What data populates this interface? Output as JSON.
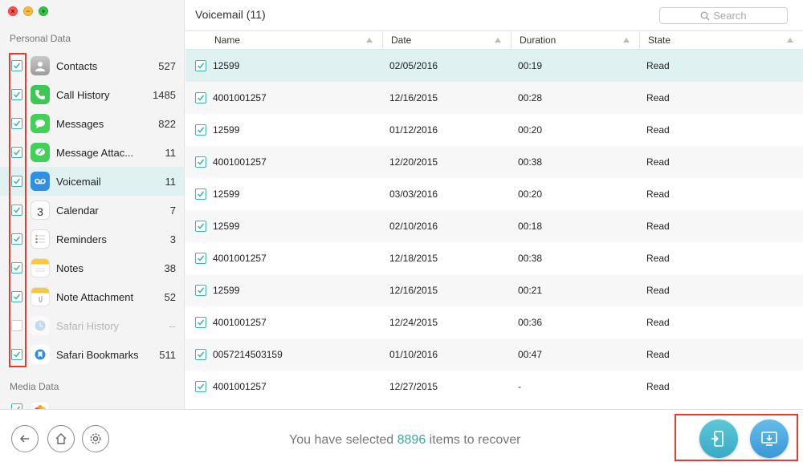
{
  "sidebar": {
    "personal_heading": "Personal Data",
    "media_heading": "Media Data",
    "items": [
      {
        "label": "Contacts",
        "count": "527",
        "icon": "contacts-icon",
        "checked": true
      },
      {
        "label": "Call History",
        "count": "1485",
        "icon": "phone-icon",
        "checked": true
      },
      {
        "label": "Messages",
        "count": "822",
        "icon": "messages-icon",
        "checked": true
      },
      {
        "label": "Message Attac...",
        "count": "11",
        "icon": "attachment-icon",
        "checked": true
      },
      {
        "label": "Voicemail",
        "count": "11",
        "icon": "voicemail-icon",
        "checked": true
      },
      {
        "label": "Calendar",
        "count": "7",
        "icon": "calendar-icon",
        "checked": true
      },
      {
        "label": "Reminders",
        "count": "3",
        "icon": "reminders-icon",
        "checked": true
      },
      {
        "label": "Notes",
        "count": "38",
        "icon": "notes-icon",
        "checked": true
      },
      {
        "label": "Note Attachment",
        "count": "52",
        "icon": "note-attachment-icon",
        "checked": true
      },
      {
        "label": "Safari History",
        "count": "--",
        "icon": "safari-history-icon",
        "checked": false
      },
      {
        "label": "Safari Bookmarks",
        "count": "511",
        "icon": "safari-bookmarks-icon",
        "checked": true
      }
    ],
    "calendar_day": "3"
  },
  "main": {
    "title": "Voicemail (11)",
    "search_placeholder": "Search",
    "columns": [
      "Name",
      "Date",
      "Duration",
      "State"
    ],
    "rows": [
      {
        "name": "12599",
        "date": "02/05/2016",
        "duration": "00:19",
        "state": "Read"
      },
      {
        "name": "4001001257",
        "date": "12/16/2015",
        "duration": "00:28",
        "state": "Read"
      },
      {
        "name": "12599",
        "date": "01/12/2016",
        "duration": "00:20",
        "state": "Read"
      },
      {
        "name": "4001001257",
        "date": "12/20/2015",
        "duration": "00:38",
        "state": "Read"
      },
      {
        "name": "12599",
        "date": "03/03/2016",
        "duration": "00:20",
        "state": "Read"
      },
      {
        "name": "12599",
        "date": "02/10/2016",
        "duration": "00:18",
        "state": "Read"
      },
      {
        "name": "4001001257",
        "date": "12/18/2015",
        "duration": "00:38",
        "state": "Read"
      },
      {
        "name": "12599",
        "date": "12/16/2015",
        "duration": "00:21",
        "state": "Read"
      },
      {
        "name": "4001001257",
        "date": "12/24/2015",
        "duration": "00:36",
        "state": "Read"
      },
      {
        "name": "0057214503159",
        "date": "01/10/2016",
        "duration": "00:47",
        "state": "Read"
      },
      {
        "name": "4001001257",
        "date": "12/27/2015",
        "duration": "-",
        "state": "Read"
      }
    ]
  },
  "footer": {
    "status_prefix": "You have selected ",
    "selected_count": "8896",
    "status_suffix": " items to recover"
  },
  "colors": {
    "accent": "#3aa79a",
    "selected_row": "#dff1f0",
    "highlight_box": "#e53c2f"
  }
}
